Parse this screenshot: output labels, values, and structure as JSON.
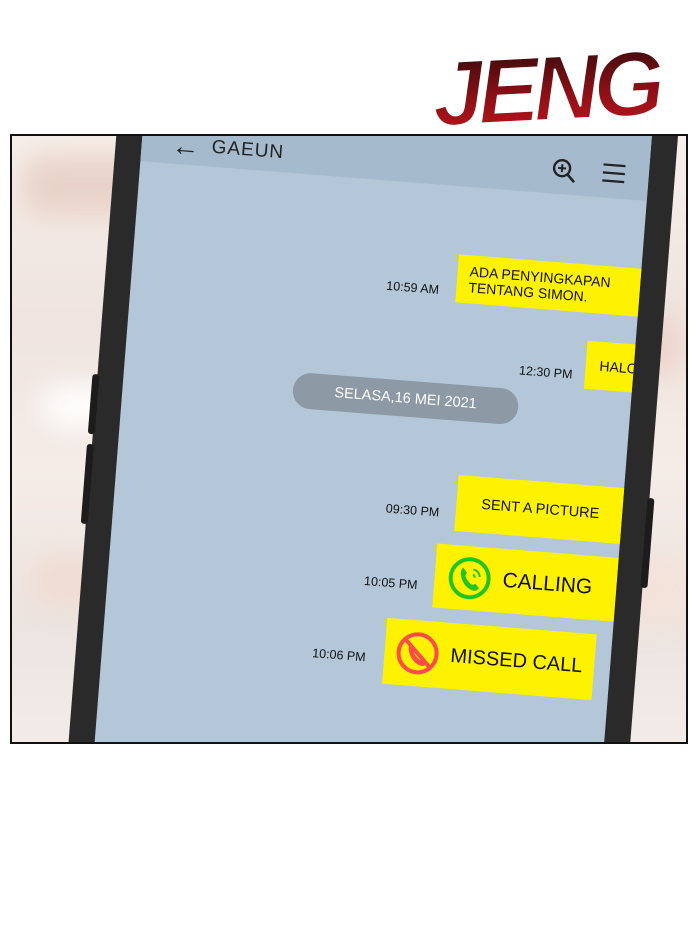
{
  "sfx": {
    "text": "JENG"
  },
  "chat": {
    "contact_name": "GAEUN",
    "messages": [
      {
        "text_line1": "ADA PENYINGKAPAN",
        "text_line2": "TENTANG SIMON.",
        "time": "10:59 AM",
        "read": "1"
      },
      {
        "text": "HALO~",
        "time": "12:30 PM",
        "read": "1"
      },
      {
        "text": "SENT A PICTURE",
        "time": "09:30 PM",
        "read": "1"
      },
      {
        "text": "CALLING",
        "time": "10:05 PM",
        "read": "1",
        "icon": "phone-call-icon",
        "icon_color": "#22c422"
      },
      {
        "text": "MISSED CALL",
        "time": "10:06 PM",
        "read": "1",
        "icon": "missed-call-icon",
        "icon_color": "#ff4b4b"
      }
    ],
    "date_separator": "SELASA,16 MEI 2021"
  },
  "colors": {
    "bubble": "#fff200",
    "screen": "#b4c7d9",
    "header": "#a6bacd",
    "sfx": "#b3151b"
  }
}
